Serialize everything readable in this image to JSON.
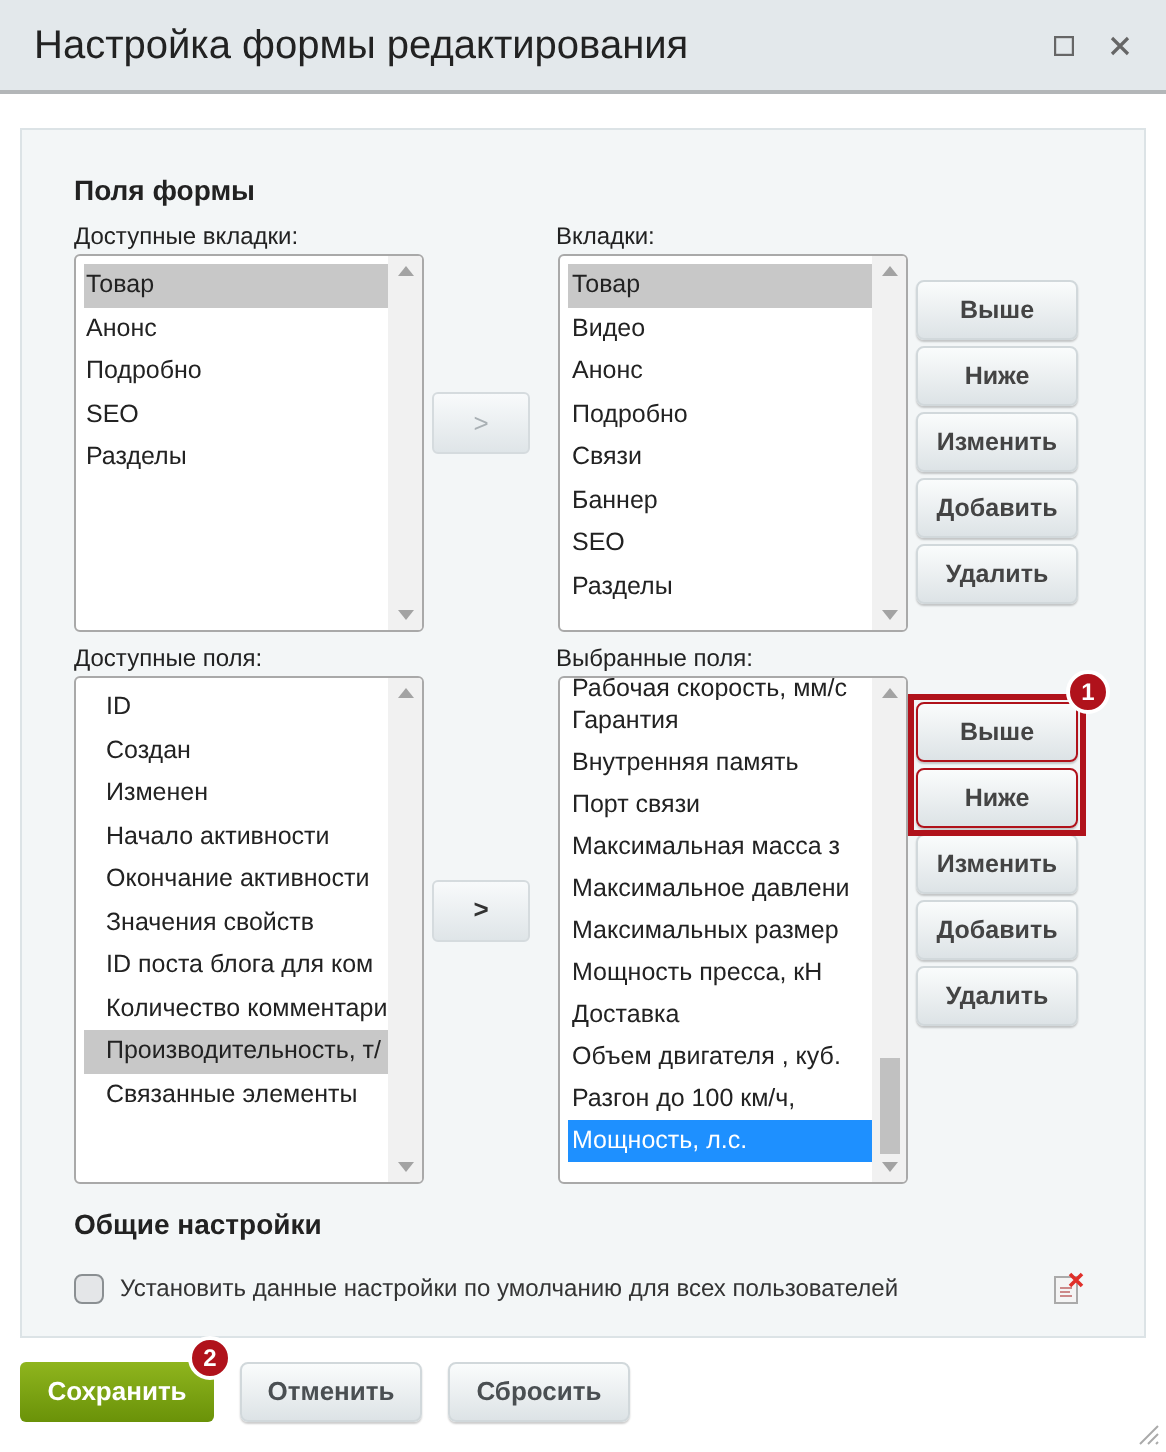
{
  "window": {
    "title": "Настройка формы редактирования"
  },
  "form_fields": {
    "title": "Поля формы",
    "top_row": {
      "available": {
        "label": "Доступные вкладки:",
        "focused": false,
        "items": [
          {
            "label": "Товар",
            "selected": true
          },
          {
            "label": "Анонс",
            "selected": false
          },
          {
            "label": "Подробно",
            "selected": false
          },
          {
            "label": "SEO",
            "selected": false
          },
          {
            "label": "Разделы",
            "selected": false
          }
        ]
      },
      "move_button": {
        "label": ">",
        "disabled": true
      },
      "chosen": {
        "label": "Вкладки:",
        "focused": false,
        "items": [
          {
            "label": "Товар",
            "selected": true
          },
          {
            "label": "Видео",
            "selected": false
          },
          {
            "label": "Анонс",
            "selected": false
          },
          {
            "label": "Подробно",
            "selected": false
          },
          {
            "label": "Связи",
            "selected": false
          },
          {
            "label": "Баннер",
            "selected": false
          },
          {
            "label": "SEO",
            "selected": false
          },
          {
            "label": "Разделы",
            "selected": false
          }
        ]
      },
      "buttons": [
        {
          "label": "Выше",
          "highlighted": false
        },
        {
          "label": "Ниже",
          "highlighted": false
        },
        {
          "label": "Изменить",
          "highlighted": false
        },
        {
          "label": "Добавить",
          "highlighted": false
        },
        {
          "label": "Удалить",
          "highlighted": false
        }
      ]
    },
    "bottom_row": {
      "available": {
        "label": "Доступные поля:",
        "focused": false,
        "items": [
          {
            "label": "ID",
            "selected": false
          },
          {
            "label": "Создан",
            "selected": false
          },
          {
            "label": "Изменен",
            "selected": false
          },
          {
            "label": "Начало активности",
            "selected": false
          },
          {
            "label": "Окончание активности",
            "selected": false
          },
          {
            "label": "Значения свойств",
            "selected": false
          },
          {
            "label": "ID поста блога для ком",
            "selected": false
          },
          {
            "label": "Количество комментари",
            "selected": false
          },
          {
            "label": "Производительность, т/",
            "selected": true
          },
          {
            "label": "Связанные элементы",
            "selected": false
          }
        ]
      },
      "move_button": {
        "label": ">",
        "disabled": false
      },
      "chosen": {
        "label": "Выбранные поля:",
        "focused": true,
        "items": [
          {
            "label": "Рабочая скорость, мм/с",
            "selected": false
          },
          {
            "label": "Гарантия",
            "selected": false
          },
          {
            "label": "Внутренняя память",
            "selected": false
          },
          {
            "label": "Порт связи",
            "selected": false
          },
          {
            "label": "Максимальная масса з",
            "selected": false
          },
          {
            "label": "Максимальное давлени",
            "selected": false
          },
          {
            "label": "Максимальных размер",
            "selected": false
          },
          {
            "label": "Мощность пресса, кН",
            "selected": false
          },
          {
            "label": "Доставка",
            "selected": false
          },
          {
            "label": "Объем двигателя , куб.",
            "selected": false
          },
          {
            "label": "Разгон до 100 км/ч,",
            "selected": false
          },
          {
            "label": "Мощность, л.с.",
            "selected": true
          }
        ]
      },
      "buttons": [
        {
          "label": "Выше",
          "highlighted": true
        },
        {
          "label": "Ниже",
          "highlighted": true
        },
        {
          "label": "Изменить",
          "highlighted": false
        },
        {
          "label": "Добавить",
          "highlighted": false
        },
        {
          "label": "Удалить",
          "highlighted": false
        }
      ],
      "highlight_badge": "1"
    }
  },
  "general": {
    "title": "Общие настройки",
    "checkbox": {
      "label": "Установить данные настройки по умолчанию для всех пользователей",
      "checked": false
    }
  },
  "footer": {
    "buttons": [
      {
        "label": "Сохранить",
        "kind": "primary",
        "badge": "2"
      },
      {
        "label": "Отменить",
        "kind": "default"
      },
      {
        "label": "Сбросить",
        "kind": "default"
      }
    ]
  }
}
